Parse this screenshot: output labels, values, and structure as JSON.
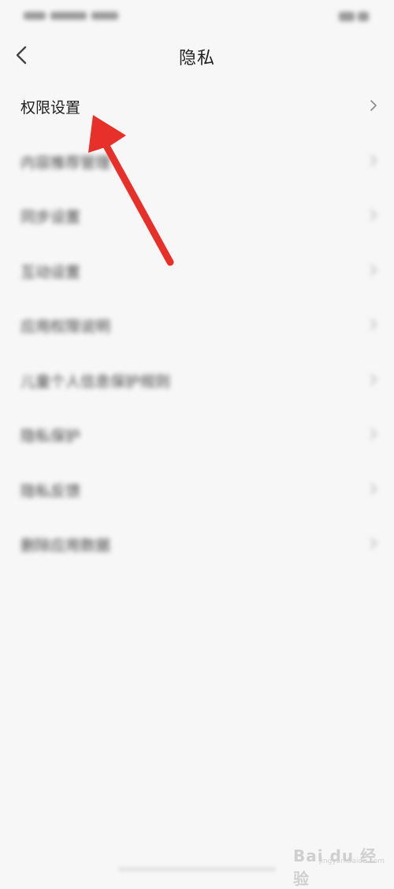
{
  "status_bar": {
    "left_text": "",
    "right_text": ""
  },
  "header": {
    "back_icon": "chevron-left-icon",
    "title": "隐私"
  },
  "menu": {
    "items": [
      {
        "label": "权限设置",
        "icon": "chevron-right-icon"
      },
      {
        "label": "内容推荐管理",
        "icon": "chevron-right-icon"
      },
      {
        "label": "同步设置",
        "icon": "chevron-right-icon"
      },
      {
        "label": "互动设置",
        "icon": "chevron-right-icon"
      },
      {
        "label": "应用权限说明",
        "icon": "chevron-right-icon"
      },
      {
        "label": "儿童个人信息保护规则",
        "icon": "chevron-right-icon"
      },
      {
        "label": "隐私保护",
        "icon": "chevron-right-icon"
      },
      {
        "label": "隐私反馈",
        "icon": "chevron-right-icon"
      },
      {
        "label": "删除应用数据",
        "icon": "chevron-right-icon"
      }
    ]
  },
  "annotation": {
    "arrow_color": "#e8302a",
    "icon": "red-arrow-annotation"
  },
  "watermark": {
    "brand": "Bai du 经验",
    "sub": "jingyan.baidu.com"
  },
  "colors": {
    "background": "#f7f7f7",
    "text": "#1e1e1e",
    "chevron": "#9a9a9a"
  }
}
